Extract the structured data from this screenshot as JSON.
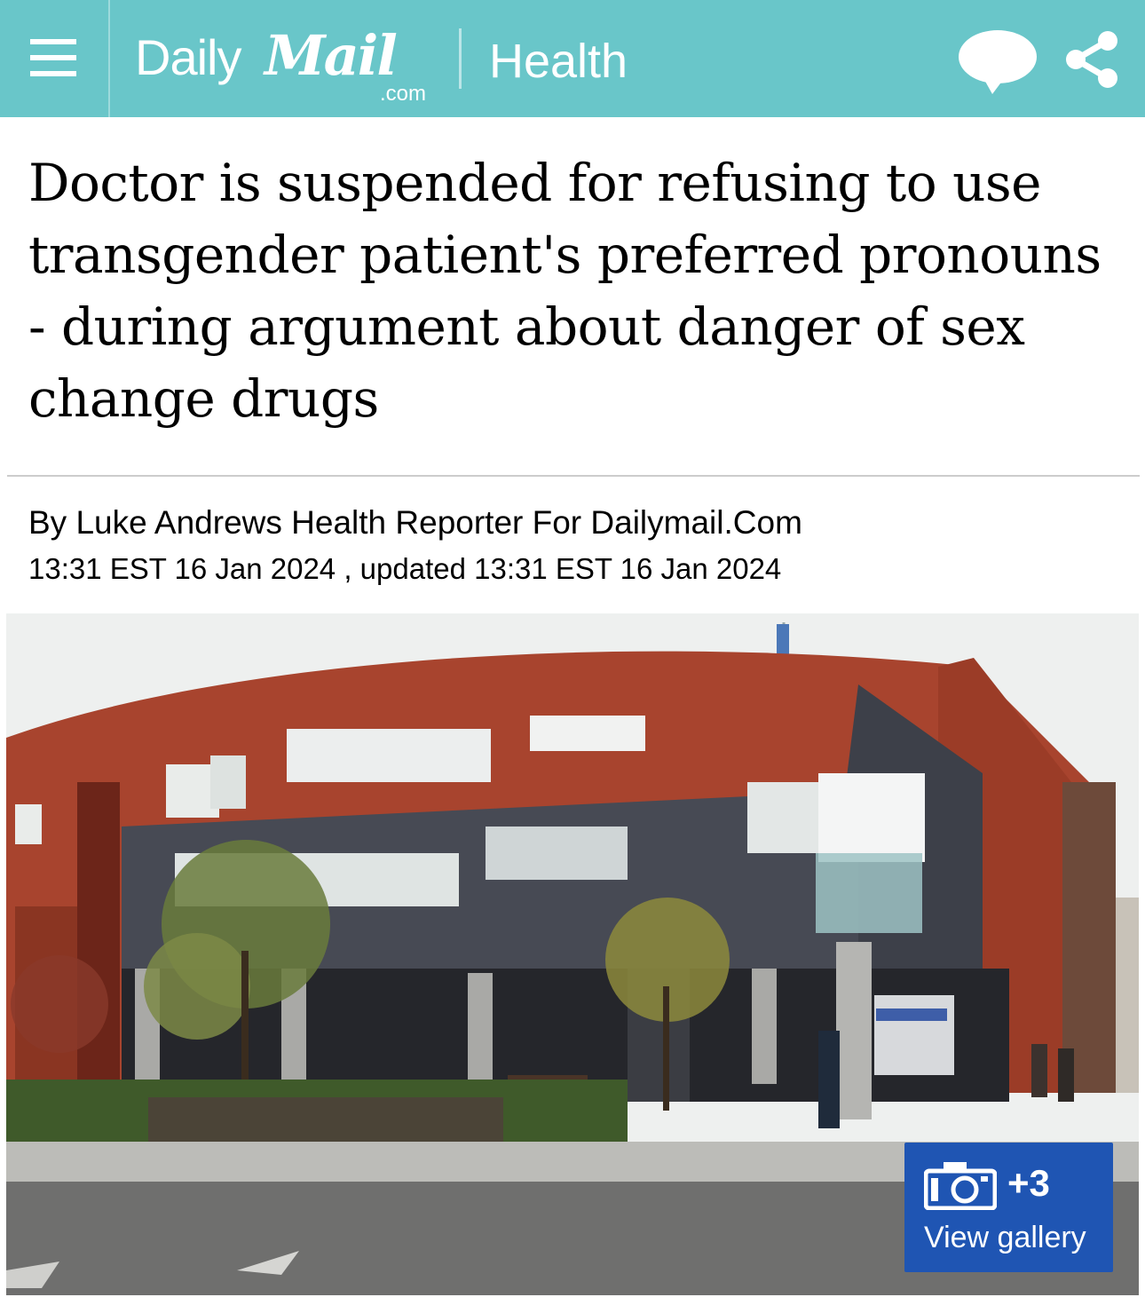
{
  "header": {
    "logo_daily": "Daily",
    "logo_mail": "Mail",
    "logo_com": ".com",
    "section": "Health",
    "menu_icon": "hamburger-menu-icon",
    "comment_icon": "speech-bubble-icon",
    "share_icon": "share-icon",
    "bar_color": "#69c6c9"
  },
  "article": {
    "headline": "Doctor is suspended for refusing to use transgender patient's preferred pronouns - during argument about danger of sex change drugs",
    "byline": "By Luke Andrews Health Reporter For Dailymail.Com",
    "dateline": "13:31 EST 16 Jan 2024 , updated 13:31 EST 16 Jan 2024"
  },
  "gallery": {
    "count": "+3",
    "label": "View gallery",
    "icon": "camera-icon",
    "button_color": "#1f55b3"
  }
}
